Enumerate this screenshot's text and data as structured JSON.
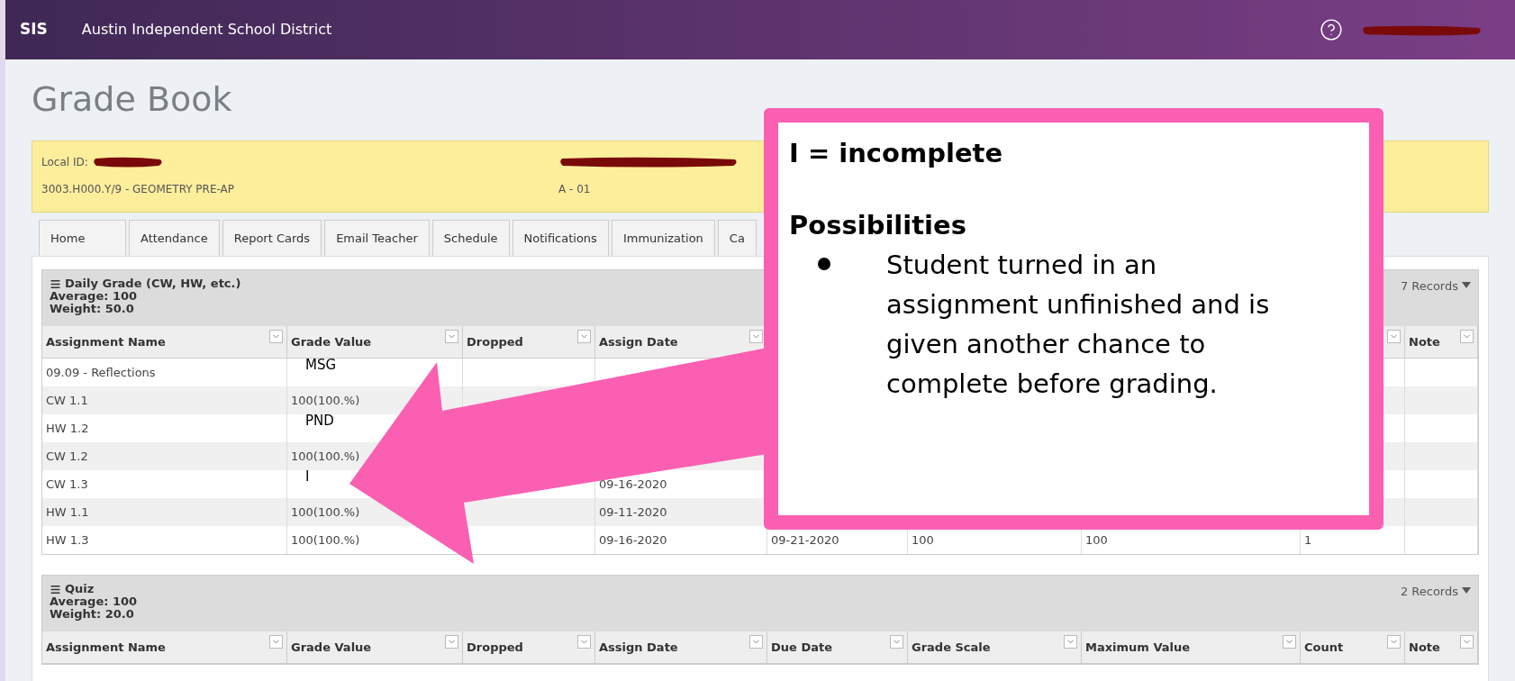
{
  "header": {
    "logo": "SIS",
    "district": "Austin Independent School District"
  },
  "page_title": "Grade Book",
  "info": {
    "local_id_label": "Local ID:",
    "course": "3003.H000.Y/9 - GEOMETRY PRE-AP",
    "section": "A - 01"
  },
  "tabs": [
    {
      "label": "Home"
    },
    {
      "label": "Attendance"
    },
    {
      "label": "Report Cards"
    },
    {
      "label": "Email Teacher"
    },
    {
      "label": "Schedule"
    },
    {
      "label": "Notifications"
    },
    {
      "label": "Immunization"
    },
    {
      "label": "Ca"
    }
  ],
  "sections": [
    {
      "title": "Daily Grade (CW, HW, etc.)",
      "average": "Average: 100",
      "weight": "Weight: 50.0",
      "records": "7 Records",
      "columns": [
        "Assignment Name",
        "Grade Value",
        "Dropped",
        "Assign Date"
      ],
      "trailing_columns": [
        "Note"
      ],
      "rows": [
        {
          "name": "09.09 - Reflections",
          "grade_note": "MSG"
        },
        {
          "name": "CW 1.1",
          "grade": "100(100.%)"
        },
        {
          "name": "HW 1.2",
          "grade_note": "PND"
        },
        {
          "name": "CW 1.2",
          "grade": "100(100.%)"
        },
        {
          "name": "CW 1.3",
          "grade_note": "I",
          "assign": "09-16-2020"
        },
        {
          "name": "HW 1.1",
          "grade": "100(100.%)",
          "assign": "09-11-2020"
        },
        {
          "name": "HW 1.3",
          "grade": "100(100.%)",
          "assign": "09-16-2020",
          "due": "09-21-2020",
          "scale": "100",
          "max": "100",
          "count": "1"
        }
      ]
    },
    {
      "title": "Quiz",
      "average": "Average: 100",
      "weight": "Weight: 20.0",
      "records": "2 Records",
      "columns": [
        "Assignment Name",
        "Grade Value",
        "Dropped",
        "Assign Date",
        "Due Date",
        "Grade Scale",
        "Maximum Value",
        "Count",
        "Note"
      ]
    }
  ],
  "callout": {
    "heading": "I = incomplete",
    "subheading": "Possibilities",
    "bullets": [
      "Student turned in an assignment unfinished and is given another chance to complete before grading."
    ]
  }
}
